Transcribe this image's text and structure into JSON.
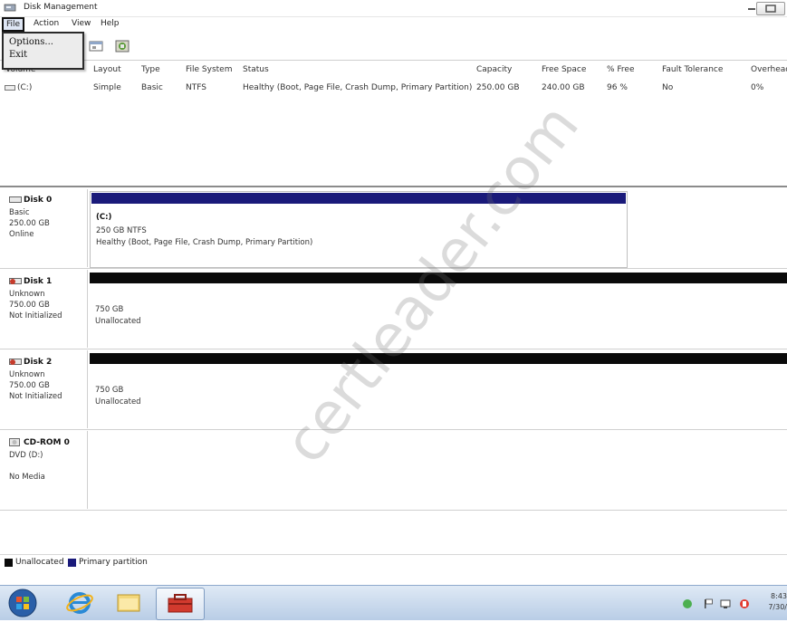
{
  "window": {
    "title": "Disk Management"
  },
  "menu": {
    "file": "File",
    "action": "Action",
    "view": "View",
    "help": "Help"
  },
  "file_menu": {
    "options": "Options...",
    "exit": "Exit"
  },
  "volume_table": {
    "columns": [
      "Volume",
      "Layout",
      "Type",
      "File System",
      "Status",
      "Capacity",
      "Free Space",
      "% Free",
      "Fault Tolerance",
      "Overhead"
    ],
    "rows": [
      {
        "volume": "(C:)",
        "layout": "Simple",
        "type": "Basic",
        "file_system": "NTFS",
        "status": "Healthy (Boot, Page File, Crash Dump, Primary Partition)",
        "capacity": "250.00 GB",
        "free_space": "240.00 GB",
        "percent_free": "96 %",
        "fault_tolerance": "No",
        "overhead": "0%"
      }
    ]
  },
  "disks": [
    {
      "name": "Disk 0",
      "type": "Basic",
      "size": "250.00 GB",
      "status": "Online",
      "partition": {
        "label": "(C:)",
        "size_fs": "250 GB NTFS",
        "status": "Healthy (Boot, Page File, Crash Dump, Primary Partition)",
        "kind": "primary"
      }
    },
    {
      "name": "Disk 1",
      "type": "Unknown",
      "size": "750.00 GB",
      "status": "Not Initialized",
      "partition": {
        "size": "750 GB",
        "status": "Unallocated",
        "kind": "unallocated"
      }
    },
    {
      "name": "Disk 2",
      "type": "Unknown",
      "size": "750.00 GB",
      "status": "Not Initialized",
      "partition": {
        "size": "750 GB",
        "status": "Unallocated",
        "kind": "unallocated"
      }
    },
    {
      "name": "CD-ROM 0",
      "type": "DVD (D:)",
      "status": "No Media"
    }
  ],
  "legend": {
    "unallocated": "Unallocated",
    "primary": "Primary partition"
  },
  "colors": {
    "primary": "#1a1a7a",
    "unallocated": "#0a0a0a",
    "taskbar": "#c9d9ee"
  },
  "clock": {
    "time": "8:43",
    "date": "7/30/"
  },
  "watermark": "certleader.com"
}
